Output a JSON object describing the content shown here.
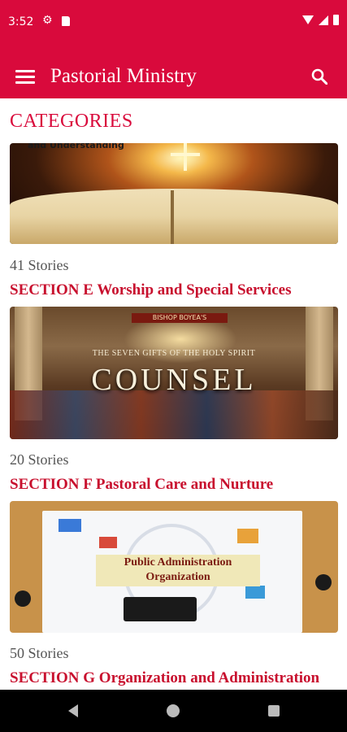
{
  "status_bar": {
    "time": "3:52"
  },
  "app_bar": {
    "title": "Pastorial Ministry"
  },
  "page": {
    "heading": "CATEGORIES"
  },
  "categories": [
    {
      "image_caption": "and Understanding",
      "stories": "41 Stories",
      "title": "SECTION E Worship and Special Services"
    },
    {
      "image_banner": "BISHOP BOYEA'S",
      "image_subtitle": "THE SEVEN GIFTS OF THE HOLY SPIRIT",
      "image_word": "COUNSEL",
      "stories": "20 Stories",
      "title": "SECTION F Pastoral Care and Nurture"
    },
    {
      "image_caption_line1": "Public Administration",
      "image_caption_line2": "Organization",
      "stories": "50 Stories",
      "title": "SECTION G Organization and Administration"
    }
  ],
  "colors": {
    "primary": "#d90a3c",
    "section_title": "#c8102e"
  }
}
